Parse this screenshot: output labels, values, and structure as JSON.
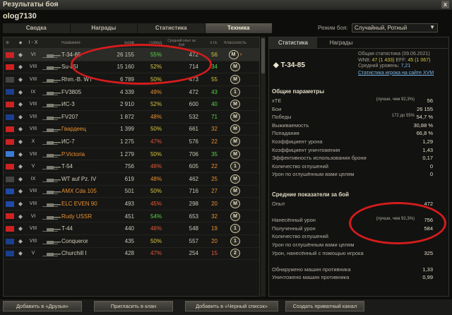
{
  "window": {
    "title": "Результаты боя",
    "close": "x"
  },
  "player": "olog7130",
  "tabs": [
    "Сводка",
    "Награды",
    "Статистика",
    "Техника"
  ],
  "active_tab": 3,
  "mode": {
    "label": "Режим боя:",
    "value": "Случайный, Ротный"
  },
  "table": {
    "headers": {
      "tier": "I - X",
      "name": "Название",
      "battles": "Боев",
      "win": "Побед",
      "xp": "Средний опыт за бой",
      "xte": "xTE",
      "mastery": "Классность"
    },
    "rows": [
      {
        "tier": "VI",
        "name": "T-34-85",
        "battles": "26 155",
        "win": "55%",
        "wc": "g",
        "xp": "472",
        "xte": "56",
        "xc": "y",
        "mark": "M",
        "arrow": "›",
        "sel": true
      },
      {
        "tier": "VIII",
        "name": "Su-85I",
        "battles": "15 160",
        "win": "52%",
        "wc": "y",
        "xp": "714",
        "xte": "34",
        "xc": "g",
        "mark": "M"
      },
      {
        "tier": "VIII",
        "name": "Rhm.-B. WT",
        "battles": "6 789",
        "win": "50%",
        "wc": "y",
        "xp": "473",
        "xte": "55",
        "xc": "y",
        "mark": "M"
      },
      {
        "tier": "IX",
        "name": "FV3805",
        "battles": "4 339",
        "win": "49%",
        "wc": "o",
        "xp": "472",
        "xte": "43",
        "xc": "g",
        "mark": "1"
      },
      {
        "tier": "VIII",
        "name": "ИС-3",
        "battles": "2 910",
        "win": "52%",
        "wc": "y",
        "xp": "600",
        "xte": "40",
        "xc": "g",
        "mark": "M"
      },
      {
        "tier": "VIII",
        "name": "FV207",
        "battles": "1 872",
        "win": "48%",
        "wc": "o",
        "xp": "532",
        "xte": "71",
        "xc": "g",
        "mark": "M"
      },
      {
        "tier": "VIII",
        "name": "Гвардеец",
        "battles": "1 399",
        "win": "50%",
        "wc": "y",
        "xp": "661",
        "xte": "32",
        "xc": "o",
        "mark": "M",
        "gold": true
      },
      {
        "tier": "X",
        "name": "ИС-7",
        "battles": "1 275",
        "win": "47%",
        "wc": "r",
        "xp": "576",
        "xte": "22",
        "xc": "o",
        "mark": "M"
      },
      {
        "tier": "VIII",
        "name": "P.Victoria",
        "battles": "1 279",
        "win": "50%",
        "wc": "y",
        "xp": "706",
        "xte": "35",
        "xc": "g",
        "mark": "M",
        "gold": true
      },
      {
        "tier": "V",
        "name": "T-54",
        "battles": "756",
        "win": "46%",
        "wc": "r",
        "xp": "605",
        "xte": "22",
        "xc": "o",
        "mark": "1"
      },
      {
        "tier": "IX",
        "name": "WT auf Pz. IV",
        "battles": "619",
        "win": "48%",
        "wc": "o",
        "xp": "462",
        "xte": "25",
        "xc": "o",
        "mark": "M"
      },
      {
        "tier": "VIII",
        "name": "AMX Cda 105",
        "battles": "501",
        "win": "50%",
        "wc": "y",
        "xp": "716",
        "xte": "27",
        "xc": "o",
        "mark": "M",
        "gold": true
      },
      {
        "tier": "VIII",
        "name": "ELC EVEN 90",
        "battles": "493",
        "win": "45%",
        "wc": "r",
        "xp": "298",
        "xte": "20",
        "xc": "o",
        "mark": "M",
        "gold": true
      },
      {
        "tier": "VI",
        "name": "Rudy USSR",
        "battles": "451",
        "win": "54%",
        "wc": "g",
        "xp": "653",
        "xte": "32",
        "xc": "o",
        "mark": "M",
        "gold": true
      },
      {
        "tier": "VIII",
        "name": "T-44",
        "battles": "440",
        "win": "46%",
        "wc": "r",
        "xp": "548",
        "xte": "19",
        "xc": "o",
        "mark": "1"
      },
      {
        "tier": "VIII",
        "name": "Conqueror",
        "battles": "435",
        "win": "50%",
        "wc": "y",
        "xp": "557",
        "xte": "20",
        "xc": "o",
        "mark": "1"
      },
      {
        "tier": "V",
        "name": "Churchill I",
        "battles": "428",
        "win": "47%",
        "wc": "r",
        "xp": "254",
        "xte": "15",
        "xc": "r",
        "mark": "2"
      }
    ]
  },
  "right": {
    "tabs": [
      "Статистика",
      "Награды"
    ],
    "tank": "T-34-85",
    "general_line1": "Общая статистика (09.06.2021)",
    "general_line2_prefix": "WN8:",
    "wn8": "47",
    "wn8_battles": "(1 433)",
    "eff_prefix": "EFF:",
    "eff": "45",
    "eff_battles": "(1 067)",
    "avg_level_label": "Средний уровень:",
    "avg_level": "7,21",
    "xvm_link": "Статистика игрока на сайте XVM",
    "section1": "Общие параметры",
    "params": [
      {
        "label": "xTE",
        "note": "(лучше, чем 92,3%)",
        "value": "56",
        "vc": "y"
      },
      {
        "label": "Бои",
        "value": "26 155"
      },
      {
        "label": "Победы",
        "note": "172 до 55%",
        "value": "54,7 %",
        "nc": "y"
      },
      {
        "label": "Выживаемость",
        "value": "30,88 %"
      },
      {
        "label": "Попадания",
        "value": "66,8 %"
      },
      {
        "label": "Коэффициент урона",
        "value": "1,29"
      },
      {
        "label": "Коэффициент уничтожения",
        "value": "1,43"
      },
      {
        "label": "Эффективность использования брони",
        "value": "0,17"
      },
      {
        "label": "Количество оглушений",
        "value": "0"
      },
      {
        "label": "Урон по оглушённым вами целям",
        "value": "0"
      }
    ],
    "section2": "Средние показатели за бой",
    "avg": [
      {
        "label": "Опыт",
        "value": "472"
      },
      {
        "label": "",
        "value": ""
      },
      {
        "label": "Нанесённый урон",
        "note": "(лучше, чем 92,3%)",
        "value": "756",
        "vc": "y"
      },
      {
        "label": "Полученный урон",
        "value": "584"
      },
      {
        "label": "Количество оглушений",
        "value": ""
      },
      {
        "label": "Урон по оглушённым вами целям",
        "value": ""
      },
      {
        "label": "Урон, нанесённый с помощью игрока",
        "value": "325"
      },
      {
        "label": "",
        "value": ""
      },
      {
        "label": "Обнаружено машин противника",
        "value": "1,33"
      },
      {
        "label": "Уничтожено машин противника",
        "value": "0,99"
      }
    ]
  },
  "buttons": [
    "Добавить в «Друзья»",
    "Пригласить в клан",
    "Добавить в «Черный список»",
    "Создать приватный канал"
  ],
  "colors": {
    "accent_red": "#d41c1c",
    "good": "#5ad44a",
    "ok": "#d9c63f",
    "bad": "#e85a3a"
  }
}
